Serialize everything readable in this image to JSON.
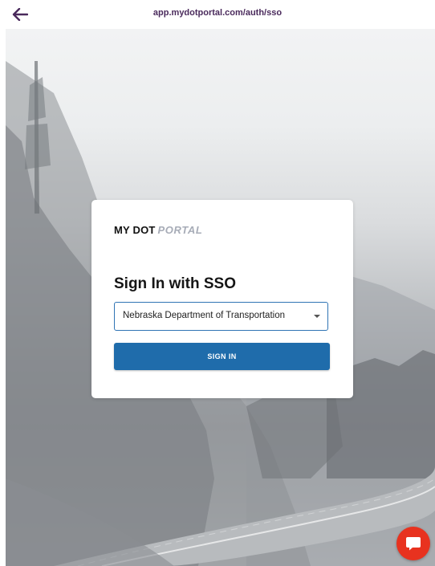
{
  "browser": {
    "url": "app.mydotportal.com/auth/sso",
    "back_icon": "arrow-left-icon"
  },
  "card": {
    "logo_my": "MY DOT",
    "logo_portal": "PORTAL",
    "title": "Sign In with SSO",
    "organization_select": {
      "selected": "Nebraska Department of Transportation",
      "icon": "chevron-down-icon"
    },
    "signin_label": "SIGN IN"
  },
  "chat": {
    "icon": "chat-bubble-icon"
  },
  "colors": {
    "brand_dark": "#4a2a5c",
    "primary_button": "#1f6cab",
    "select_border": "#2f74b4",
    "chat_button": "#e8321f",
    "logo_portal": "#a7acb7"
  }
}
